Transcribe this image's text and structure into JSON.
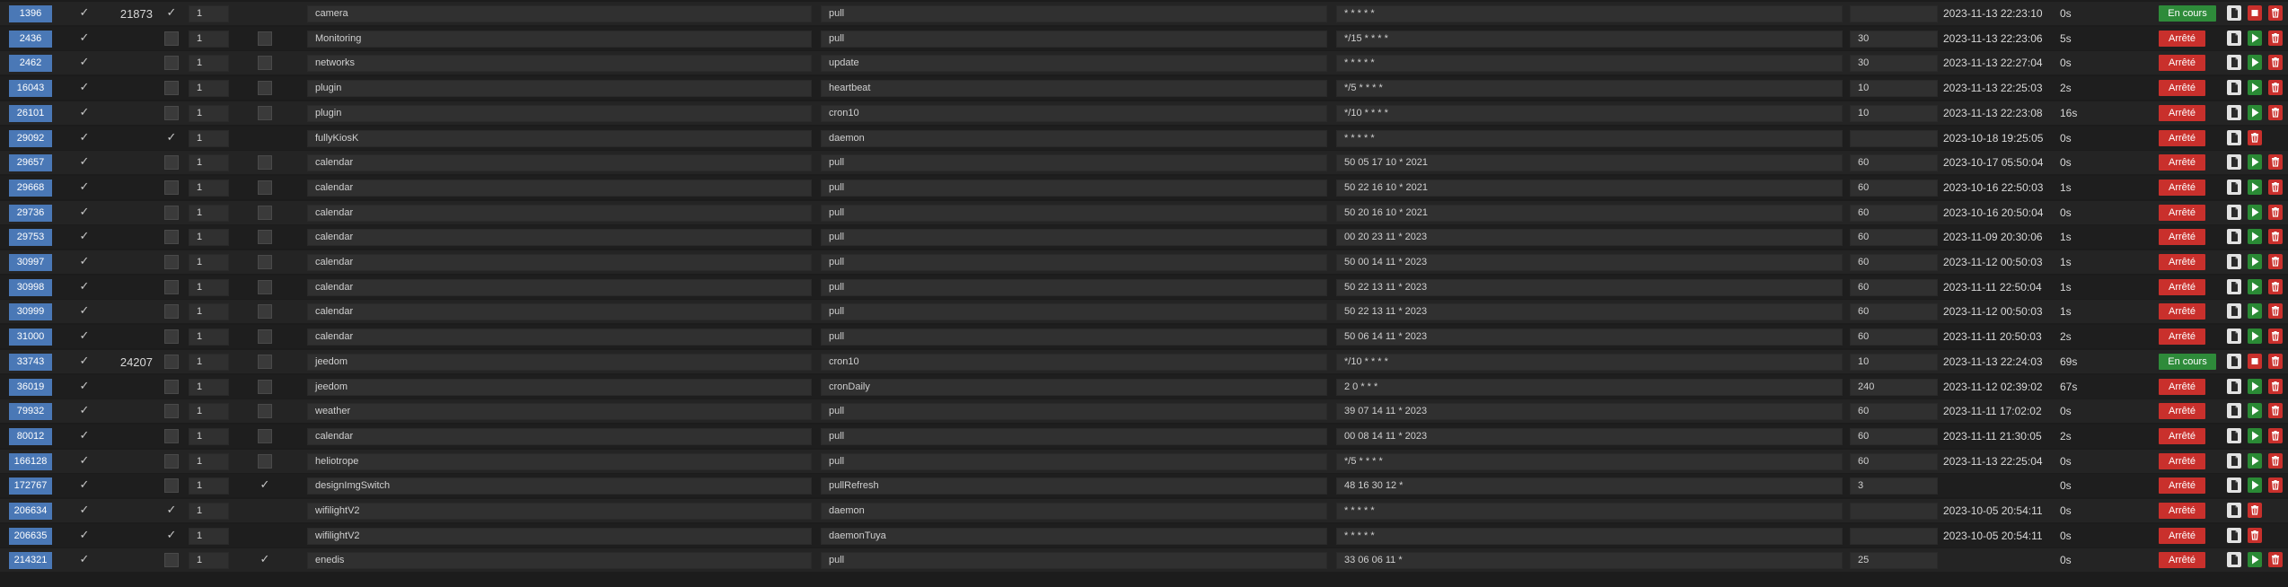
{
  "colors": {
    "id_badge": "#4a78b6",
    "state_running": "#2e8b3a",
    "state_stopped": "#c9302c",
    "play_button": "#2a8a35",
    "delete_button": "#c9302c"
  },
  "icons": {
    "enabled_check": "check-icon",
    "log": "file-icon",
    "start": "play-icon",
    "stop": "stop-icon",
    "remove": "trash-icon"
  },
  "rows": [
    {
      "id": "1396",
      "enabled": true,
      "pid": "21873",
      "deamon": true,
      "max": "1",
      "once": null,
      "class": "camera",
      "function": "pull",
      "schedule": "* * * * *",
      "timeout": "",
      "last_run": "2023-11-13 22:23:10",
      "duration": "0s",
      "state": "En cours",
      "running": true,
      "can_start": false
    },
    {
      "id": "2436",
      "enabled": true,
      "pid": "",
      "deamon": false,
      "max": "1",
      "once": false,
      "class": "Monitoring",
      "function": "pull",
      "schedule": "*/15 * * * *",
      "timeout": "30",
      "last_run": "2023-11-13 22:23:06",
      "duration": "5s",
      "state": "Arrêté",
      "running": false,
      "can_start": true
    },
    {
      "id": "2462",
      "enabled": true,
      "pid": "",
      "deamon": false,
      "max": "1",
      "once": false,
      "class": "networks",
      "function": "update",
      "schedule": "* * * * *",
      "timeout": "30",
      "last_run": "2023-11-13 22:27:04",
      "duration": "0s",
      "state": "Arrêté",
      "running": false,
      "can_start": true
    },
    {
      "id": "16043",
      "enabled": true,
      "pid": "",
      "deamon": false,
      "max": "1",
      "once": false,
      "class": "plugin",
      "function": "heartbeat",
      "schedule": "*/5 * * * *",
      "timeout": "10",
      "last_run": "2023-11-13 22:25:03",
      "duration": "2s",
      "state": "Arrêté",
      "running": false,
      "can_start": true
    },
    {
      "id": "26101",
      "enabled": true,
      "pid": "",
      "deamon": false,
      "max": "1",
      "once": false,
      "class": "plugin",
      "function": "cron10",
      "schedule": "*/10 * * * *",
      "timeout": "10",
      "last_run": "2023-11-13 22:23:08",
      "duration": "16s",
      "state": "Arrêté",
      "running": false,
      "can_start": true
    },
    {
      "id": "29092",
      "enabled": true,
      "pid": "",
      "deamon": true,
      "max": "1",
      "once": null,
      "class": "fullyKiosK",
      "function": "daemon",
      "schedule": "* * * * *",
      "timeout": "",
      "last_run": "2023-10-18 19:25:05",
      "duration": "0s",
      "state": "Arrêté",
      "running": false,
      "can_start": false
    },
    {
      "id": "29657",
      "enabled": true,
      "pid": "",
      "deamon": false,
      "max": "1",
      "once": false,
      "class": "calendar",
      "function": "pull",
      "schedule": "50 05 17 10 * 2021",
      "timeout": "60",
      "last_run": "2023-10-17 05:50:04",
      "duration": "0s",
      "state": "Arrêté",
      "running": false,
      "can_start": true
    },
    {
      "id": "29668",
      "enabled": true,
      "pid": "",
      "deamon": false,
      "max": "1",
      "once": false,
      "class": "calendar",
      "function": "pull",
      "schedule": "50 22 16 10 * 2021",
      "timeout": "60",
      "last_run": "2023-10-16 22:50:03",
      "duration": "1s",
      "state": "Arrêté",
      "running": false,
      "can_start": true
    },
    {
      "id": "29736",
      "enabled": true,
      "pid": "",
      "deamon": false,
      "max": "1",
      "once": false,
      "class": "calendar",
      "function": "pull",
      "schedule": "50 20 16 10 * 2021",
      "timeout": "60",
      "last_run": "2023-10-16 20:50:04",
      "duration": "0s",
      "state": "Arrêté",
      "running": false,
      "can_start": true
    },
    {
      "id": "29753",
      "enabled": true,
      "pid": "",
      "deamon": false,
      "max": "1",
      "once": false,
      "class": "calendar",
      "function": "pull",
      "schedule": "00 20 23 11 * 2023",
      "timeout": "60",
      "last_run": "2023-11-09 20:30:06",
      "duration": "1s",
      "state": "Arrêté",
      "running": false,
      "can_start": true
    },
    {
      "id": "30997",
      "enabled": true,
      "pid": "",
      "deamon": false,
      "max": "1",
      "once": false,
      "class": "calendar",
      "function": "pull",
      "schedule": "50 00 14 11 * 2023",
      "timeout": "60",
      "last_run": "2023-11-12 00:50:03",
      "duration": "1s",
      "state": "Arrêté",
      "running": false,
      "can_start": true
    },
    {
      "id": "30998",
      "enabled": true,
      "pid": "",
      "deamon": false,
      "max": "1",
      "once": false,
      "class": "calendar",
      "function": "pull",
      "schedule": "50 22 13 11 * 2023",
      "timeout": "60",
      "last_run": "2023-11-11 22:50:04",
      "duration": "1s",
      "state": "Arrêté",
      "running": false,
      "can_start": true
    },
    {
      "id": "30999",
      "enabled": true,
      "pid": "",
      "deamon": false,
      "max": "1",
      "once": false,
      "class": "calendar",
      "function": "pull",
      "schedule": "50 22 13 11 * 2023",
      "timeout": "60",
      "last_run": "2023-11-12 00:50:03",
      "duration": "1s",
      "state": "Arrêté",
      "running": false,
      "can_start": true
    },
    {
      "id": "31000",
      "enabled": true,
      "pid": "",
      "deamon": false,
      "max": "1",
      "once": false,
      "class": "calendar",
      "function": "pull",
      "schedule": "50 06 14 11 * 2023",
      "timeout": "60",
      "last_run": "2023-11-11 20:50:03",
      "duration": "2s",
      "state": "Arrêté",
      "running": false,
      "can_start": true
    },
    {
      "id": "33743",
      "enabled": true,
      "pid": "24207",
      "deamon": false,
      "max": "1",
      "once": false,
      "class": "jeedom",
      "function": "cron10",
      "schedule": "*/10 * * * *",
      "timeout": "10",
      "last_run": "2023-11-13 22:24:03",
      "duration": "69s",
      "state": "En cours",
      "running": true,
      "can_start": true
    },
    {
      "id": "36019",
      "enabled": true,
      "pid": "",
      "deamon": false,
      "max": "1",
      "once": false,
      "class": "jeedom",
      "function": "cronDaily",
      "schedule": "2 0 * * *",
      "timeout": "240",
      "last_run": "2023-11-12 02:39:02",
      "duration": "67s",
      "state": "Arrêté",
      "running": false,
      "can_start": true
    },
    {
      "id": "79932",
      "enabled": true,
      "pid": "",
      "deamon": false,
      "max": "1",
      "once": false,
      "class": "weather",
      "function": "pull",
      "schedule": "39 07 14 11 * 2023",
      "timeout": "60",
      "last_run": "2023-11-11 17:02:02",
      "duration": "0s",
      "state": "Arrêté",
      "running": false,
      "can_start": true
    },
    {
      "id": "80012",
      "enabled": true,
      "pid": "",
      "deamon": false,
      "max": "1",
      "once": false,
      "class": "calendar",
      "function": "pull",
      "schedule": "00 08 14 11 * 2023",
      "timeout": "60",
      "last_run": "2023-11-11 21:30:05",
      "duration": "2s",
      "state": "Arrêté",
      "running": false,
      "can_start": true
    },
    {
      "id": "166128",
      "enabled": true,
      "pid": "",
      "deamon": false,
      "max": "1",
      "once": false,
      "class": "heliotrope",
      "function": "pull",
      "schedule": "*/5 * * * *",
      "timeout": "60",
      "last_run": "2023-11-13 22:25:04",
      "duration": "0s",
      "state": "Arrêté",
      "running": false,
      "can_start": true
    },
    {
      "id": "172767",
      "enabled": true,
      "pid": "",
      "deamon": false,
      "max": "1",
      "once": true,
      "class": "designImgSwitch",
      "function": "pullRefresh",
      "schedule": "48 16 30 12 *",
      "timeout": "3",
      "last_run": "",
      "duration": "0s",
      "state": "Arrêté",
      "running": false,
      "can_start": true
    },
    {
      "id": "206634",
      "enabled": true,
      "pid": "",
      "deamon": true,
      "max": "1",
      "once": null,
      "class": "wifilightV2",
      "function": "daemon",
      "schedule": "* * * * *",
      "timeout": "",
      "last_run": "2023-10-05 20:54:11",
      "duration": "0s",
      "state": "Arrêté",
      "running": false,
      "can_start": false
    },
    {
      "id": "206635",
      "enabled": true,
      "pid": "",
      "deamon": true,
      "max": "1",
      "once": null,
      "class": "wifilightV2",
      "function": "daemonTuya",
      "schedule": "* * * * *",
      "timeout": "",
      "last_run": "2023-10-05 20:54:11",
      "duration": "0s",
      "state": "Arrêté",
      "running": false,
      "can_start": false
    },
    {
      "id": "214321",
      "enabled": true,
      "pid": "",
      "deamon": false,
      "max": "1",
      "once": true,
      "class": "enedis",
      "function": "pull",
      "schedule": "33 06 06 11 *",
      "timeout": "25",
      "last_run": "",
      "duration": "0s",
      "state": "Arrêté",
      "running": false,
      "can_start": true
    }
  ]
}
